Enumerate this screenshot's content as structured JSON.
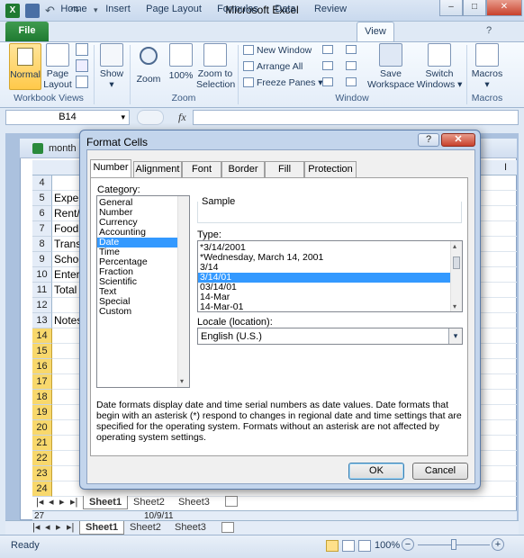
{
  "app": {
    "title": "Microsoft Excel"
  },
  "window_controls": {
    "minimize": "–",
    "restore": "□",
    "close": "✕"
  },
  "ribbon_tabs": [
    "File",
    "Home",
    "Insert",
    "Page Layout",
    "Formulas",
    "Data",
    "Review",
    "View"
  ],
  "ribbon": {
    "workbook_views": {
      "normal": "Normal",
      "page_layout_1": "Page",
      "page_layout_2": "Layout",
      "group_label": "Workbook Views"
    },
    "show": {
      "label": "Show"
    },
    "zoom": {
      "zoom": "Zoom",
      "hundred": "100%",
      "zoom_to_1": "Zoom to",
      "zoom_to_2": "Selection",
      "group_label": "Zoom"
    },
    "window": {
      "new_window": "New Window",
      "arrange_all": "Arrange All",
      "freeze_panes": "Freeze Panes",
      "save_ws_1": "Save",
      "save_ws_2": "Workspace",
      "switch_1": "Switch",
      "switch_2": "Windows",
      "group_label": "Window"
    },
    "macros": {
      "label": "Macros",
      "group_label": "Macros"
    }
  },
  "formula_bar": {
    "name_box": "B14",
    "fx": "fx"
  },
  "workbook": {
    "title": "month",
    "rows": [
      {
        "num": "4",
        "text": ""
      },
      {
        "num": "5",
        "text": "Exper"
      },
      {
        "num": "6",
        "text": "Rent/"
      },
      {
        "num": "7",
        "text": "Food"
      },
      {
        "num": "8",
        "text": "Trans"
      },
      {
        "num": "9",
        "text": "Schoo"
      },
      {
        "num": "10",
        "text": "Enter"
      },
      {
        "num": "11",
        "text": "Total"
      },
      {
        "num": "12",
        "text": ""
      },
      {
        "num": "13",
        "text": "Notes"
      },
      {
        "num": "14",
        "text": ""
      },
      {
        "num": "15",
        "text": ""
      },
      {
        "num": "16",
        "text": ""
      },
      {
        "num": "17",
        "text": ""
      },
      {
        "num": "18",
        "text": ""
      },
      {
        "num": "19",
        "text": ""
      },
      {
        "num": "20",
        "text": ""
      },
      {
        "num": "21",
        "text": ""
      },
      {
        "num": "22",
        "text": ""
      },
      {
        "num": "23",
        "text": ""
      },
      {
        "num": "24",
        "text": ""
      }
    ],
    "col_i": "I",
    "sheet_tabs": [
      "Sheet1",
      "Sheet2",
      "Sheet3"
    ],
    "bottom_row_num": "27",
    "bottom_row_value": "10/9/11"
  },
  "outer_sheet_tabs": [
    "Sheet1",
    "Sheet2",
    "Sheet3"
  ],
  "status": {
    "ready": "Ready",
    "zoom": "100%",
    "minus": "−",
    "plus": "+"
  },
  "dialog": {
    "title": "Format Cells",
    "help": "?",
    "close": "✕",
    "tabs": [
      "Number",
      "Alignment",
      "Font",
      "Border",
      "Fill",
      "Protection"
    ],
    "category_label": "Category:",
    "categories": [
      "General",
      "Number",
      "Currency",
      "Accounting",
      "Date",
      "Time",
      "Percentage",
      "Fraction",
      "Scientific",
      "Text",
      "Special",
      "Custom"
    ],
    "selected_category": "Date",
    "sample_label": "Sample",
    "type_label": "Type:",
    "types": [
      "*3/14/2001",
      "*Wednesday, March 14, 2001",
      "3/14",
      "3/14/01",
      "03/14/01",
      "14-Mar",
      "14-Mar-01"
    ],
    "selected_type": "3/14/01",
    "locale_label": "Locale (location):",
    "locale_value": "English (U.S.)",
    "description": "Date formats display date and time serial numbers as date values.  Date formats that begin with an asterisk (*) respond to changes in regional date and time settings that are specified for the operating system. Formats without an asterisk are not affected by operating system settings.",
    "ok": "OK",
    "cancel": "Cancel"
  },
  "colors": {
    "accent_selection": "#3399ff",
    "file_tab": "#2a8a3c",
    "row_header_selected": "#f8d86c"
  }
}
